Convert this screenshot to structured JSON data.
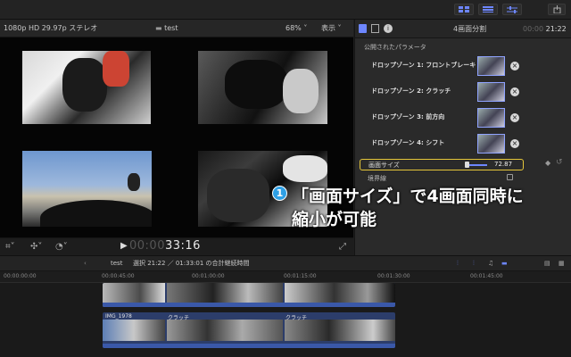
{
  "viewer_header": {
    "format": "1080p HD 29.97p ステレオ",
    "title": "test",
    "zoom": "68%",
    "display": "表示"
  },
  "viewer": {
    "timecode_dim": "00:00",
    "timecode": "33:16"
  },
  "inspector": {
    "title": "4画面分割",
    "timecode_dim": "00:00",
    "timecode": "21:22",
    "section": "公開されたパラメータ",
    "drop_zones": [
      {
        "label": "ドロップゾーン 1: フロントブレーキ"
      },
      {
        "label": "ドロップゾーン 2: クラッチ"
      },
      {
        "label": "ドロップゾーン 3: 前方向"
      },
      {
        "label": "ドロップゾーン 4: シフト"
      }
    ],
    "size_label": "画面サイズ",
    "size_value": "72.87",
    "size_fraction": 0.73,
    "border_label": "境界線"
  },
  "annotation": {
    "number": "1",
    "line1": "「画面サイズ」で4画面同時に",
    "line2": "縮小が可能"
  },
  "timeline": {
    "project": "test",
    "selection_info": "選択 21:22 ／ 01:33:01 の合計継続時間",
    "ruler": [
      "00:00:00:00",
      "00:00:45:00",
      "00:01:00:00",
      "00:01:15:00",
      "00:01:30:00",
      "00:01:45:00"
    ],
    "clips": [
      "IMG_1978",
      "クラッチ",
      "クラッチ"
    ]
  },
  "colors": {
    "accent_blue": "#3a58a8",
    "highlight_yellow": "#e5c63a",
    "annotation_circle": "#2ea0e6"
  }
}
